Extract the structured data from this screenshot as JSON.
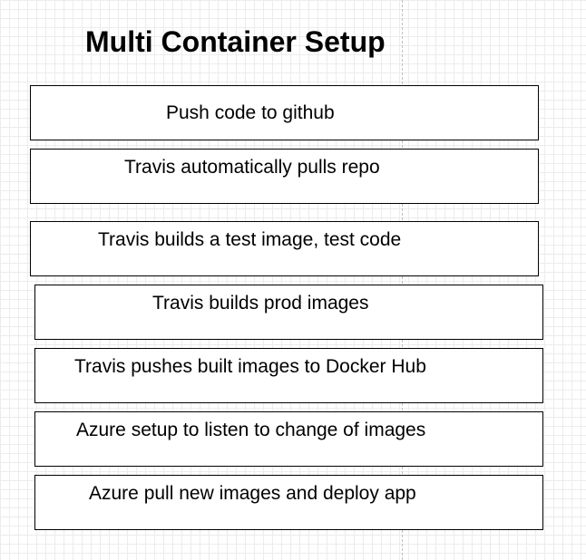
{
  "diagram": {
    "title": "Multi Container Setup",
    "steps": [
      "Push code to github",
      "Travis automatically pulls repo",
      "Travis builds a test image, test code",
      "Travis builds prod images",
      "Travis pushes built images to Docker Hub",
      "Azure setup to listen to change of images",
      "Azure pull new images and deploy app"
    ]
  },
  "colors": {
    "border": "#000000",
    "text": "#000000",
    "grid": "#ececec",
    "guide": "#c0c0c0"
  }
}
